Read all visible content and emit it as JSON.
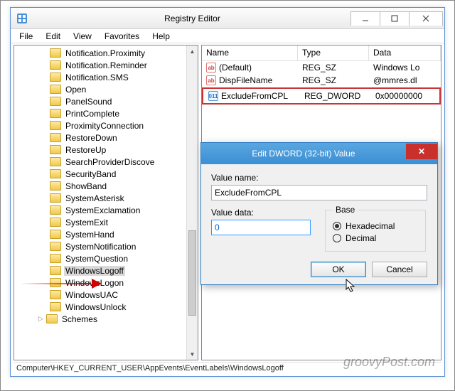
{
  "window": {
    "title": "Registry Editor"
  },
  "menu": [
    "File",
    "Edit",
    "View",
    "Favorites",
    "Help"
  ],
  "tree": {
    "items": [
      "Notification.Proximity",
      "Notification.Reminder",
      "Notification.SMS",
      "Open",
      "PanelSound",
      "PrintComplete",
      "ProximityConnection",
      "RestoreDown",
      "RestoreUp",
      "SearchProviderDiscove",
      "SecurityBand",
      "ShowBand",
      "SystemAsterisk",
      "SystemExclamation",
      "SystemExit",
      "SystemHand",
      "SystemNotification",
      "SystemQuestion",
      "WindowsLogoff",
      "WindowsLogon",
      "WindowsUAC",
      "WindowsUnlock"
    ],
    "schemes": "Schemes",
    "selected_index": 18
  },
  "list": {
    "columns": {
      "name": "Name",
      "type": "Type",
      "data": "Data"
    },
    "rows": [
      {
        "icon": "sz",
        "name": "(Default)",
        "type": "REG_SZ",
        "data": "Windows Lo"
      },
      {
        "icon": "sz",
        "name": "DispFileName",
        "type": "REG_SZ",
        "data": "@mmres.dl"
      },
      {
        "icon": "dw",
        "name": "ExcludeFromCPL",
        "type": "REG_DWORD",
        "data": "0x00000000"
      }
    ],
    "highlighted_row": 2
  },
  "status": "Computer\\HKEY_CURRENT_USER\\AppEvents\\EventLabels\\WindowsLogoff",
  "dialog": {
    "title": "Edit DWORD (32-bit) Value",
    "value_name_label": "Value name:",
    "value_name": "ExcludeFromCPL",
    "value_data_label": "Value data:",
    "value_data": "0",
    "base_legend": "Base",
    "hex_label": "Hexadecimal",
    "dec_label": "Decimal",
    "base_selected": "hex",
    "ok": "OK",
    "cancel": "Cancel"
  },
  "watermark": "groovyPost.com"
}
